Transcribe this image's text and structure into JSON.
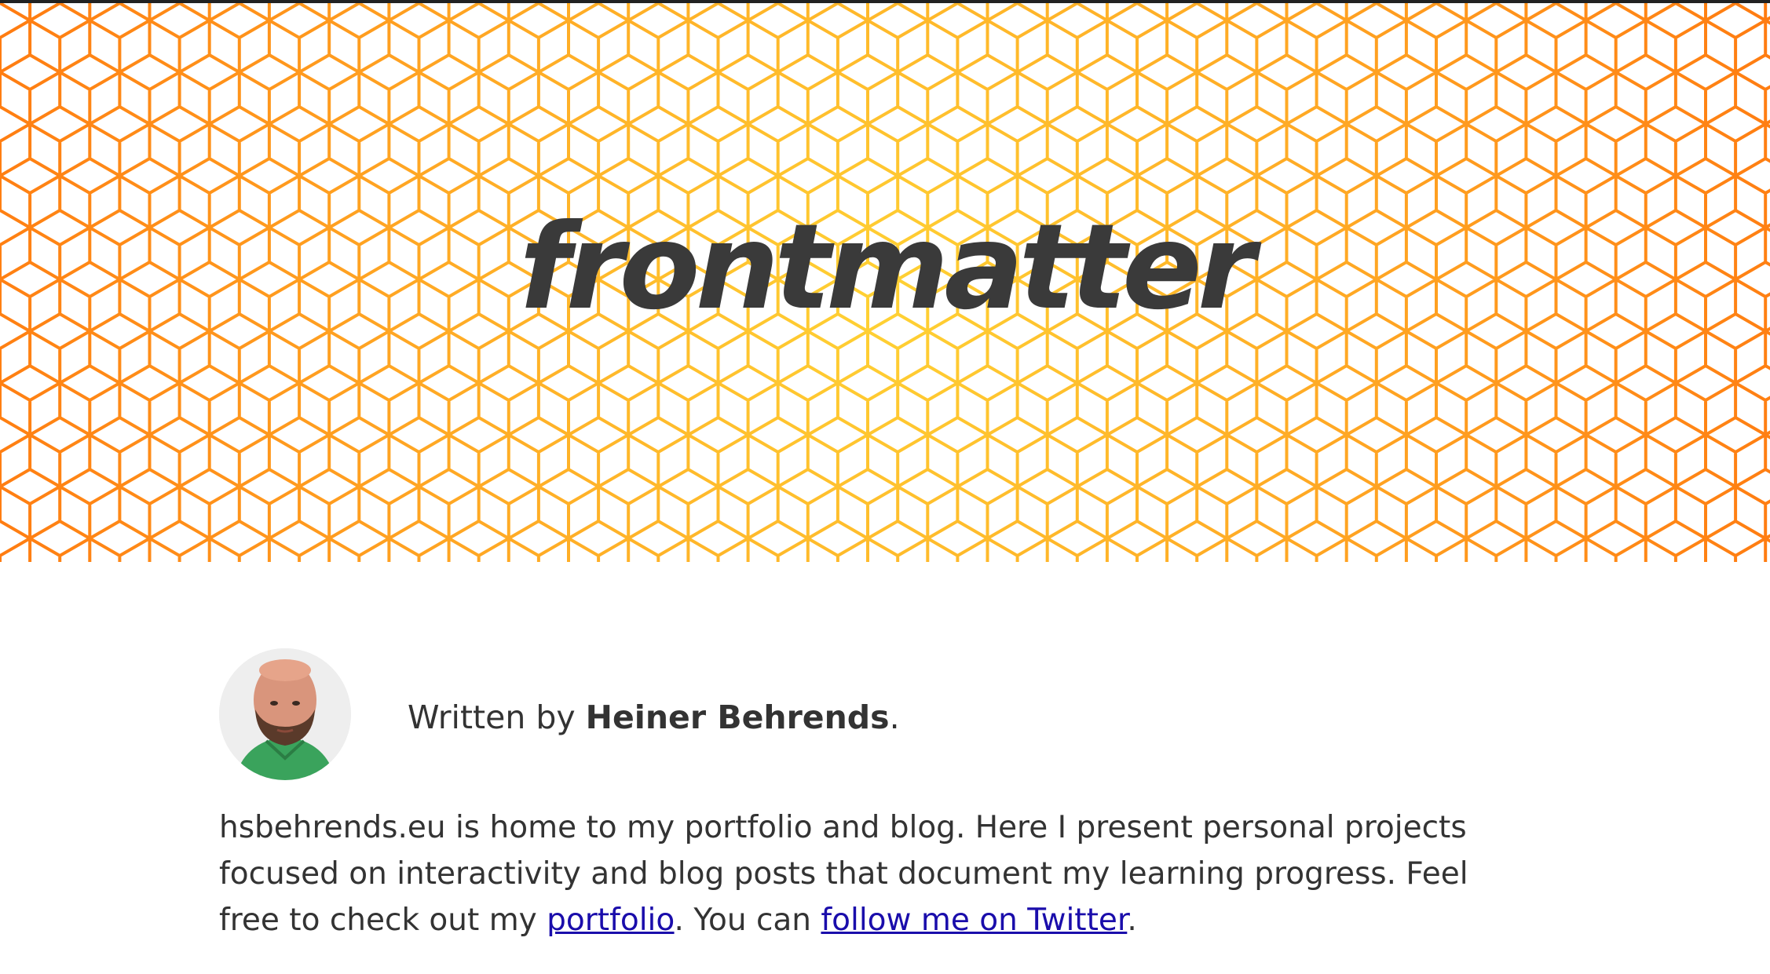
{
  "hero": {
    "title": "frontmatter",
    "pattern_colors": {
      "center": "#ffd234",
      "edge": "#ff7a10"
    }
  },
  "author": {
    "prefix": "Written by ",
    "name": "Heiner Behrends",
    "suffix": "."
  },
  "intro": {
    "text_1": "hsbehrends.eu is home to my portfolio and blog. Here I present personal projects focused on interactivity and blog posts that document my learning progress. Feel free to check out my ",
    "link_portfolio": "portfolio",
    "text_2": ". You can ",
    "link_twitter": "follow me on Twitter",
    "text_3": "."
  }
}
